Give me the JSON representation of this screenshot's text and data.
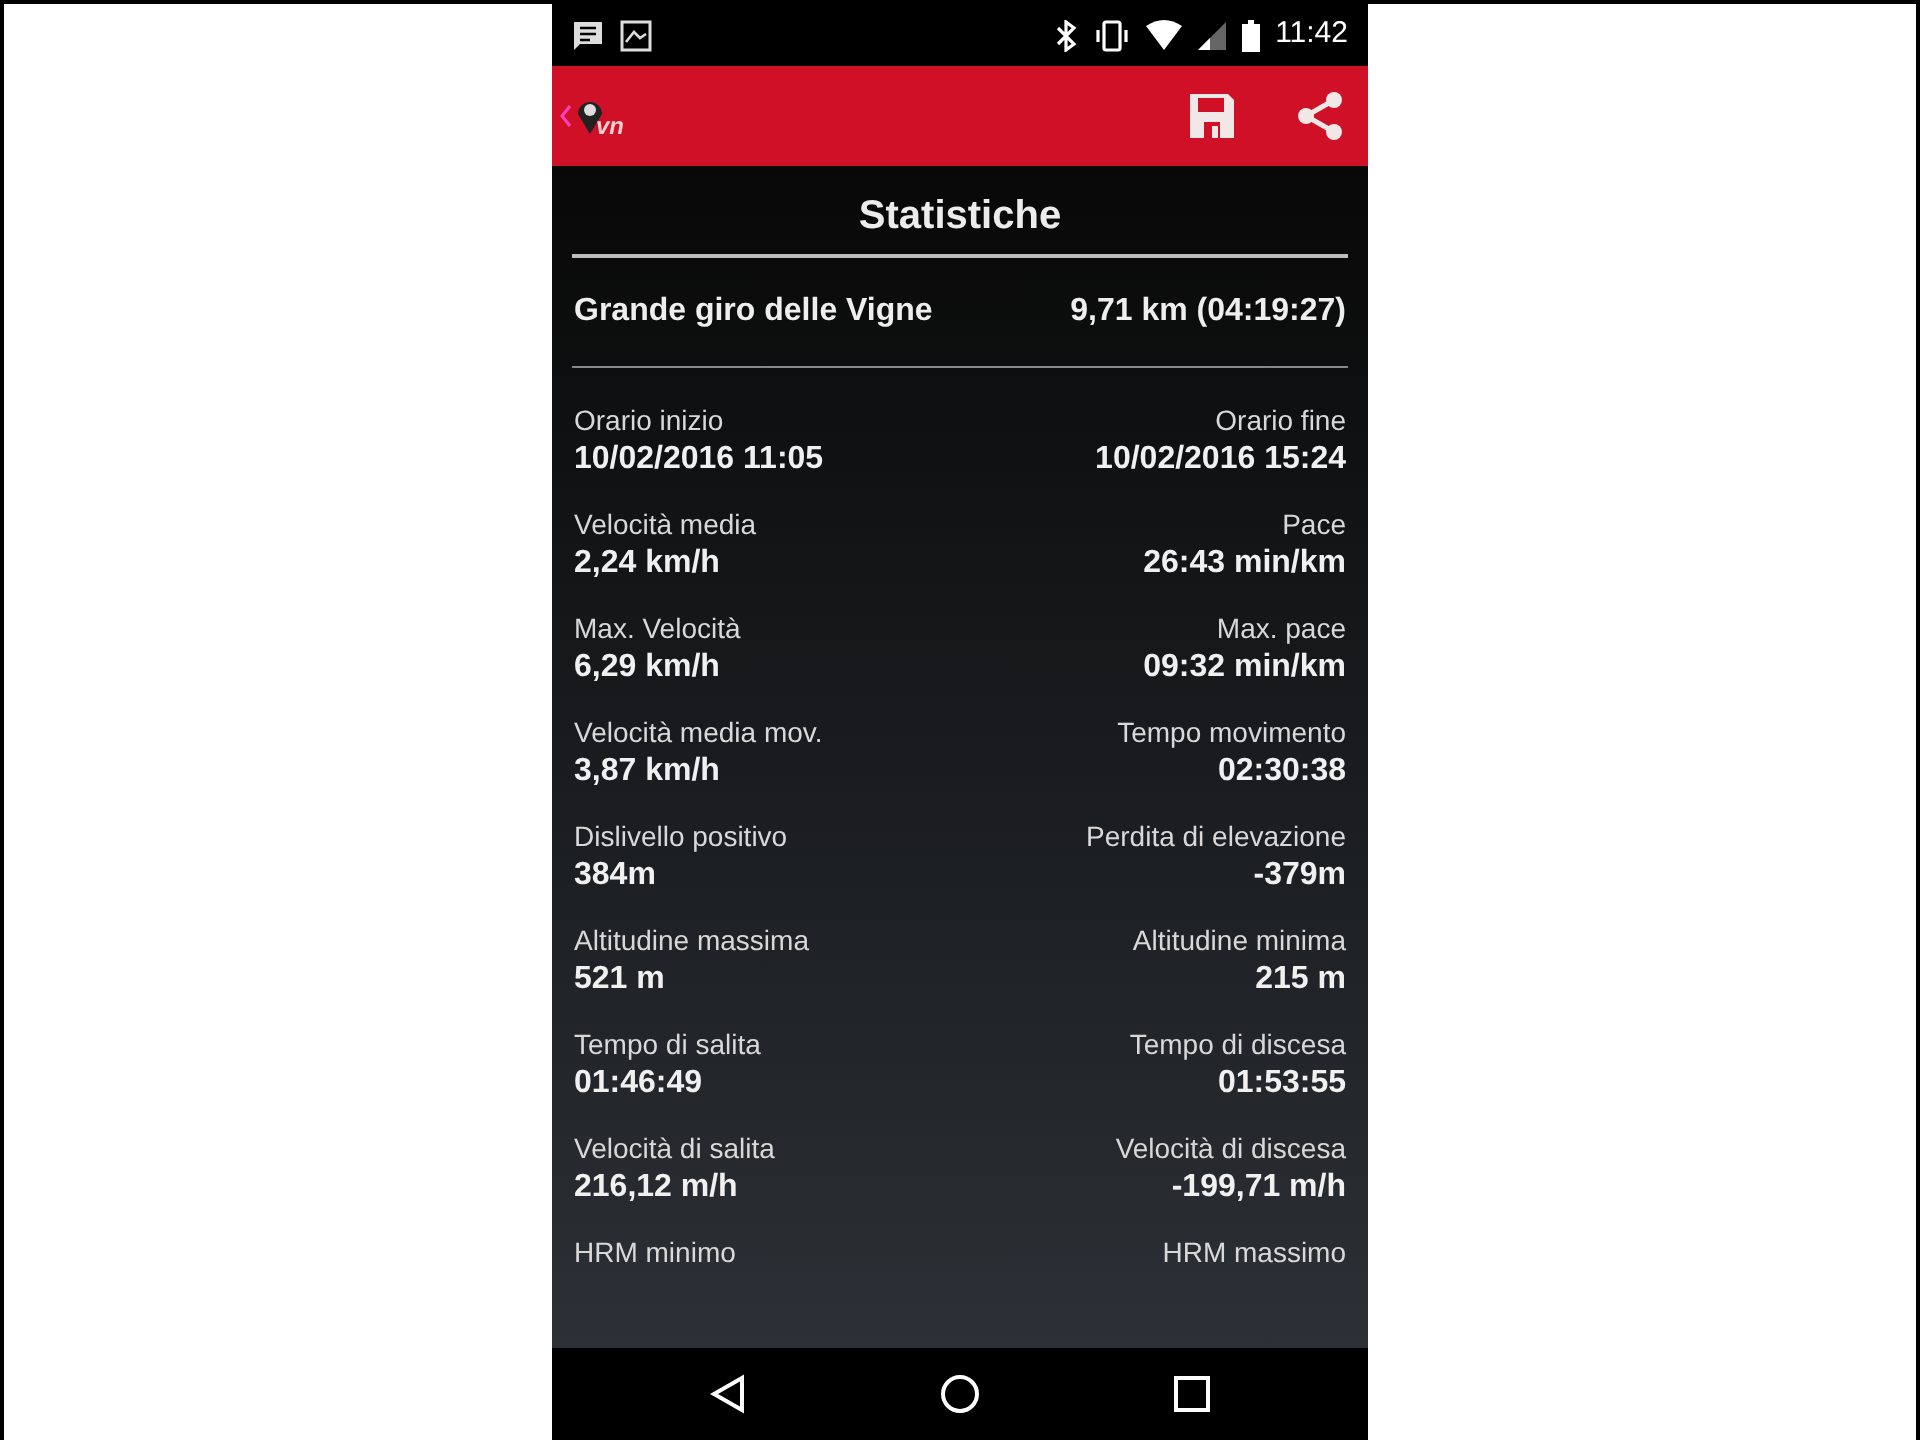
{
  "status_bar": {
    "time": "11:42"
  },
  "app_bar": {
    "logo_text": "vn"
  },
  "title": "Statistiche",
  "track": {
    "name": "Grande giro delle Vigne",
    "summary": "9,71 km (04:19:27)"
  },
  "stats": [
    {
      "left": {
        "label": "Orario inizio",
        "value": "10/02/2016 11:05"
      },
      "right": {
        "label": "Orario fine",
        "value": "10/02/2016 15:24"
      }
    },
    {
      "left": {
        "label": "Velocità media",
        "value": "2,24 km/h"
      },
      "right": {
        "label": "Pace",
        "value": "26:43 min/km"
      }
    },
    {
      "left": {
        "label": "Max. Velocità",
        "value": "6,29 km/h"
      },
      "right": {
        "label": "Max. pace",
        "value": "09:32 min/km"
      }
    },
    {
      "left": {
        "label": "Velocità media mov.",
        "value": "3,87 km/h"
      },
      "right": {
        "label": "Tempo movimento",
        "value": "02:30:38"
      }
    },
    {
      "left": {
        "label": "Dislivello positivo",
        "value": "384m"
      },
      "right": {
        "label": "Perdita di elevazione",
        "value": "-379m"
      }
    },
    {
      "left": {
        "label": "Altitudine massima",
        "value": "521 m"
      },
      "right": {
        "label": "Altitudine minima",
        "value": "215 m"
      }
    },
    {
      "left": {
        "label": "Tempo di salita",
        "value": "01:46:49"
      },
      "right": {
        "label": "Tempo di discesa",
        "value": "01:53:55"
      }
    },
    {
      "left": {
        "label": "Velocità di salita",
        "value": "216,12 m/h"
      },
      "right": {
        "label": "Velocità di discesa",
        "value": "-199,71 m/h"
      }
    },
    {
      "left": {
        "label": "HRM minimo"
      },
      "right": {
        "label": "HRM massimo"
      }
    }
  ]
}
